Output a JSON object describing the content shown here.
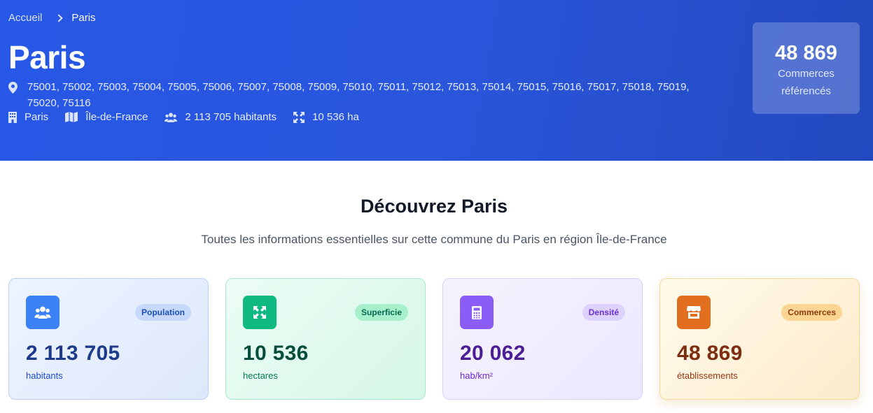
{
  "breadcrumb": {
    "home": "Accueil",
    "current": "Paris"
  },
  "hero": {
    "title": "Paris",
    "postal_codes": "75001, 75002, 75003, 75004, 75005, 75006, 75007, 75008, 75009, 75010, 75011, 75012, 75013, 75014, 75015, 75016, 75017, 75018, 75019, 75020, 75116",
    "meta": {
      "department": "Paris",
      "region": "Île-de-France",
      "population": "2 113 705 habitants",
      "area": "10 536 ha"
    },
    "badge": {
      "number": "48 869",
      "label_line1": "Commerces",
      "label_line2": "référencés"
    }
  },
  "section": {
    "title": "Découvrez Paris",
    "subtitle": "Toutes les informations essentielles sur cette commune du Paris en région Île-de-France"
  },
  "cards": [
    {
      "tag": "Population",
      "value": "2 113 705",
      "unit": "habitants",
      "icon": "users-icon",
      "color": "#3b82f6"
    },
    {
      "tag": "Superficie",
      "value": "10 536",
      "unit": "hectares",
      "icon": "expand-icon",
      "color": "#10b981"
    },
    {
      "tag": "Densité",
      "value": "20 062",
      "unit": "hab/km²",
      "icon": "calculator-icon",
      "color": "#8b5cf6"
    },
    {
      "tag": "Commerces",
      "value": "48 869",
      "unit": "établissements",
      "icon": "store-icon",
      "color": "#e26f1f"
    }
  ]
}
